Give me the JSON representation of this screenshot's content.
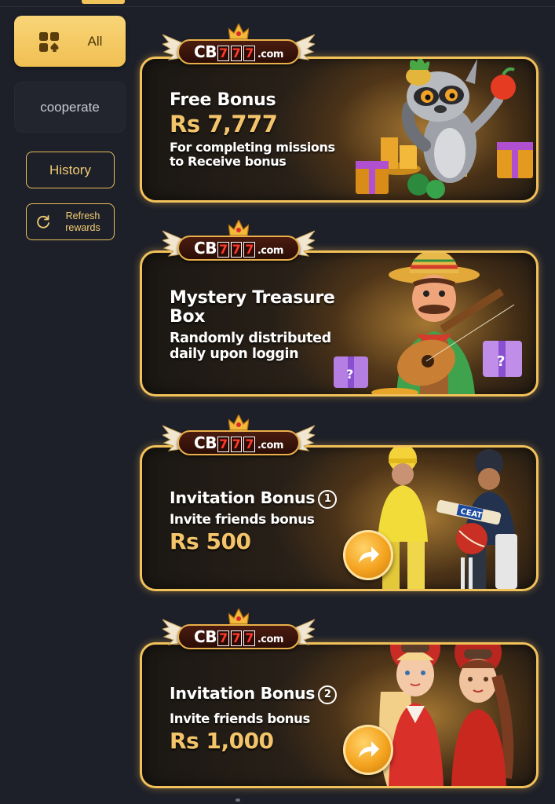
{
  "sidebar": {
    "all_label": "All",
    "cooperate_label": "cooperate",
    "history_label": "History",
    "refresh_label": "Refresh rewards"
  },
  "logo": {
    "prefix": "CB",
    "digits": [
      "7",
      "7",
      "7"
    ],
    "suffix": ".com"
  },
  "cards": [
    {
      "title": "Free Bonus",
      "amount": "Rs 7,777",
      "desc_line1": "For completing missions",
      "desc_line2": "to Receive bonus"
    },
    {
      "title_line1": "Mystery Treasure",
      "title_line2": "Box",
      "desc_line1": "Randomly distributed",
      "desc_line2": "daily upon loggin"
    },
    {
      "title": "Invitation Bonus",
      "badge": "1",
      "desc": "Invite friends bonus",
      "amount": "Rs 500"
    },
    {
      "title": "Invitation Bonus",
      "badge": "2",
      "desc": "Invite friends bonus",
      "amount": "Rs 1,000"
    }
  ],
  "colors": {
    "accent": "#f0c35b",
    "background": "#1d2029",
    "card_border": "#f1c15a",
    "amount": "#f3c46a"
  }
}
